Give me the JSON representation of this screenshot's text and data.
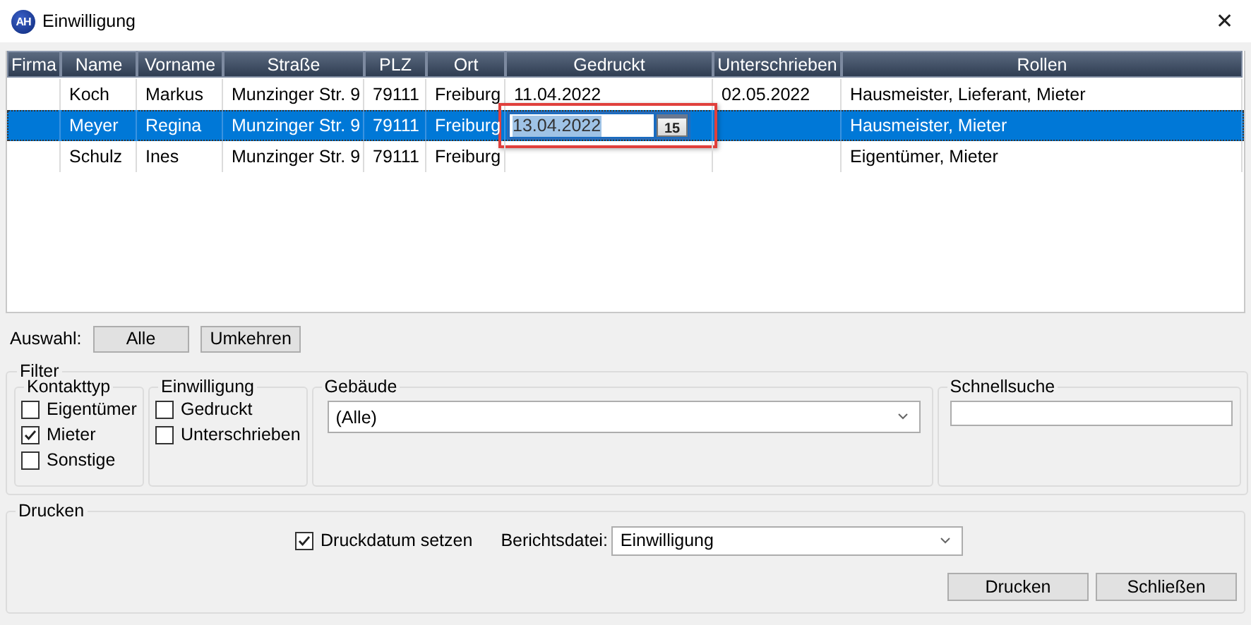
{
  "window": {
    "logo": "AH",
    "title": "Einwilligung",
    "close": "✕"
  },
  "table": {
    "columns": [
      "Firma",
      "Name",
      "Vorname",
      "Straße",
      "PLZ",
      "Ort",
      "Gedruckt",
      "Unterschrieben",
      "Rollen"
    ],
    "rows": [
      {
        "selected": false,
        "cells": [
          null,
          "Koch",
          "Markus",
          "Munzinger Str. 9",
          "79111",
          "Freiburg",
          "11.04.2022",
          "02.05.2022",
          "Hausmeister, Lieferant, Mieter"
        ]
      },
      {
        "selected": true,
        "cells": [
          null,
          "Meyer",
          "Regina",
          "Munzinger Str. 9",
          "79111",
          "Freiburg",
          {
            "kind": "date-editor",
            "value": "13.04.2022",
            "button": "15",
            "marked": true
          },
          null,
          "Hausmeister, Mieter"
        ]
      },
      {
        "selected": false,
        "cells": [
          null,
          "Schulz",
          "Ines",
          "Munzinger Str. 9",
          "79111",
          "Freiburg",
          null,
          null,
          "Eigentümer, Mieter"
        ]
      }
    ]
  },
  "selection": {
    "label": "Auswahl:",
    "buttons": [
      "Alle",
      "Umkehren"
    ]
  },
  "filter": {
    "title": "Filter",
    "contact_type": {
      "title": "Kontakttyp",
      "options": [
        {
          "label": "Eigentümer",
          "checked": false
        },
        {
          "label": "Mieter",
          "checked": true
        },
        {
          "label": "Sonstige",
          "checked": false
        }
      ]
    },
    "consent": {
      "title": "Einwilligung",
      "options": [
        {
          "label": "Gedruckt",
          "checked": false
        },
        {
          "label": "Unterschrieben",
          "checked": false
        }
      ]
    },
    "building": {
      "title": "Gebäude",
      "value": "(Alle)"
    },
    "quick_search": {
      "title": "Schnellsuche"
    }
  },
  "print": {
    "title": "Drucken",
    "set_date": {
      "label": "Druckdatum setzen",
      "checked": true
    },
    "report_label": "Berichtsdatei:",
    "report_value": "Einwilligung",
    "buttons": [
      "Drucken",
      "Schließen"
    ]
  }
}
